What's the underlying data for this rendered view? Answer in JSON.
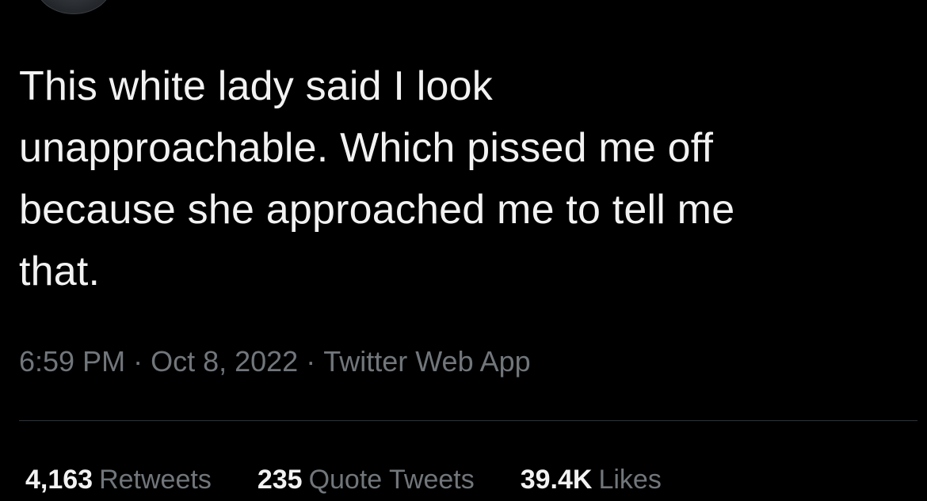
{
  "tweet": {
    "text": "This white lady said I look\nunapproachable. Which pissed me off\nbecause she approached me to tell me\nthat.",
    "time": "6:59 PM",
    "date": "Oct 8, 2022",
    "source": "Twitter Web App",
    "separator": "·"
  },
  "stats": {
    "retweets": {
      "count": "4,163",
      "label": "Retweets"
    },
    "quote_tweets": {
      "count": "235",
      "label": "Quote Tweets"
    },
    "likes": {
      "count": "39.4K",
      "label": "Likes"
    }
  },
  "colors": {
    "background": "#000000",
    "text": "#f2f2f2",
    "muted": "#71767b",
    "divider": "#2f3336"
  }
}
